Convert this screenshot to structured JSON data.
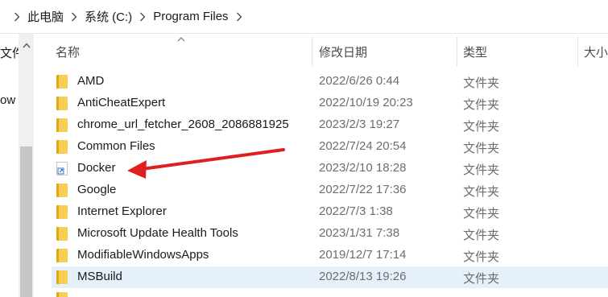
{
  "address_bar": {
    "crumbs": [
      "此电脑",
      "系统 (C:)",
      "Program Files"
    ]
  },
  "nav_pane": {
    "items": [
      "文件",
      "ow"
    ]
  },
  "columns": {
    "name": "名称",
    "date": "修改日期",
    "type": "类型",
    "size": "大小"
  },
  "files": [
    {
      "name": "AMD",
      "date": "2022/6/26 0:44",
      "type": "文件夹",
      "icon": "folder-icon"
    },
    {
      "name": "AntiCheatExpert",
      "date": "2022/10/19 20:23",
      "type": "文件夹",
      "icon": "folder-icon"
    },
    {
      "name": "chrome_url_fetcher_2608_2086881925",
      "date": "2023/2/3 19:27",
      "type": "文件夹",
      "icon": "folder-icon"
    },
    {
      "name": "Common Files",
      "date": "2022/7/24 20:54",
      "type": "文件夹",
      "icon": "folder-icon"
    },
    {
      "name": "Docker",
      "date": "2023/2/10 18:28",
      "type": "文件夹",
      "icon": "shortcut-icon"
    },
    {
      "name": "Google",
      "date": "2022/7/22 17:36",
      "type": "文件夹",
      "icon": "folder-icon"
    },
    {
      "name": "Internet Explorer",
      "date": "2022/7/3 1:38",
      "type": "文件夹",
      "icon": "folder-icon"
    },
    {
      "name": "Microsoft Update Health Tools",
      "date": "2023/1/31 7:38",
      "type": "文件夹",
      "icon": "folder-icon"
    },
    {
      "name": "ModifiableWindowsApps",
      "date": "2019/12/7 17:14",
      "type": "文件夹",
      "icon": "folder-icon"
    },
    {
      "name": "MSBuild",
      "date": "2022/8/13 19:26",
      "type": "文件夹",
      "icon": "folder-icon",
      "selected": true
    },
    {
      "name": "",
      "date": "",
      "type": "",
      "icon": "folder-icon"
    }
  ],
  "colors": {
    "selection": "#e5f0fb",
    "annotation_arrow": "#e02020",
    "folder": "#f7cf55"
  }
}
